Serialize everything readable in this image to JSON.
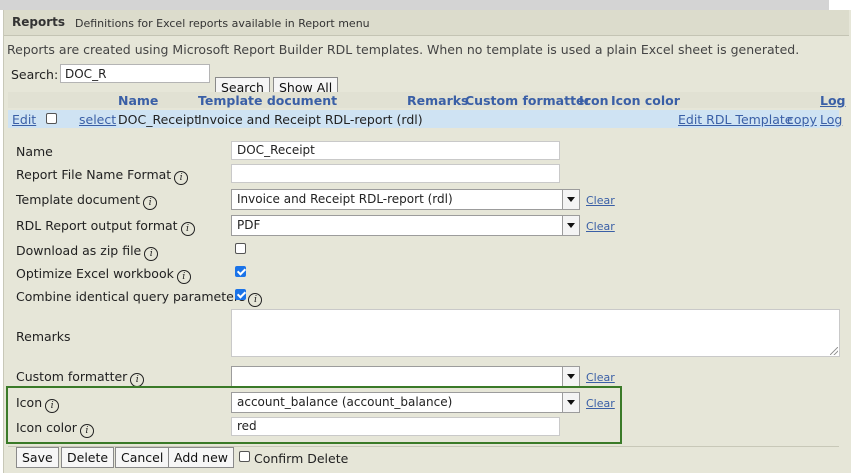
{
  "header": {
    "title": "Reports",
    "subtitle": "Definitions for Excel reports available in Report menu"
  },
  "info_text": "Reports are created using Microsoft Report Builder RDL templates. When no template is used a plain Excel sheet is generated.",
  "search": {
    "label": "Search:",
    "value": "DOC_R",
    "search_button": "Search",
    "show_all_button": "Show All"
  },
  "columns": [
    "Name",
    "Template document",
    "Remarks",
    "Custom formatter",
    "Icon",
    "Icon color",
    "Log"
  ],
  "selected_row": {
    "edit": "Edit",
    "select": "select",
    "name": "DOC_Receipt",
    "template": "Invoice and Receipt RDL-report (rdl)",
    "edit_rdl": "Edit RDL Template",
    "copy": "copy",
    "log": "Log"
  },
  "form": {
    "name_label": "Name",
    "name_value": "DOC_Receipt",
    "file_format_label": "Report File Name Format",
    "file_format_value": "",
    "template_label": "Template document",
    "template_value": "Invoice and Receipt RDL-report (rdl)",
    "output_label": "RDL Report output format",
    "output_value": "PDF",
    "zip_label": "Download as zip file",
    "zip_checked": false,
    "optimize_label": "Optimize Excel workbook",
    "optimize_checked": true,
    "combine_label": "Combine identical query parameters",
    "combine_checked": true,
    "remarks_label": "Remarks",
    "remarks_value": "",
    "formatter_label": "Custom formatter",
    "formatter_value": "",
    "icon_label": "Icon",
    "icon_value": "account_balance (account_balance)",
    "icon_color_label": "Icon color",
    "icon_color_value": "red",
    "clear_label": "Clear"
  },
  "actions": {
    "save": "Save",
    "delete": "Delete",
    "cancel": "Cancel",
    "add_new": "Add new",
    "confirm_delete": "Confirm Delete"
  },
  "colors": {
    "panel": "#e6e6d8",
    "link": "#3a5fa6",
    "selected_row": "#cfe3f3",
    "highlight_border": "#3a7a28",
    "checkbox_checked": "#1a73e8"
  }
}
